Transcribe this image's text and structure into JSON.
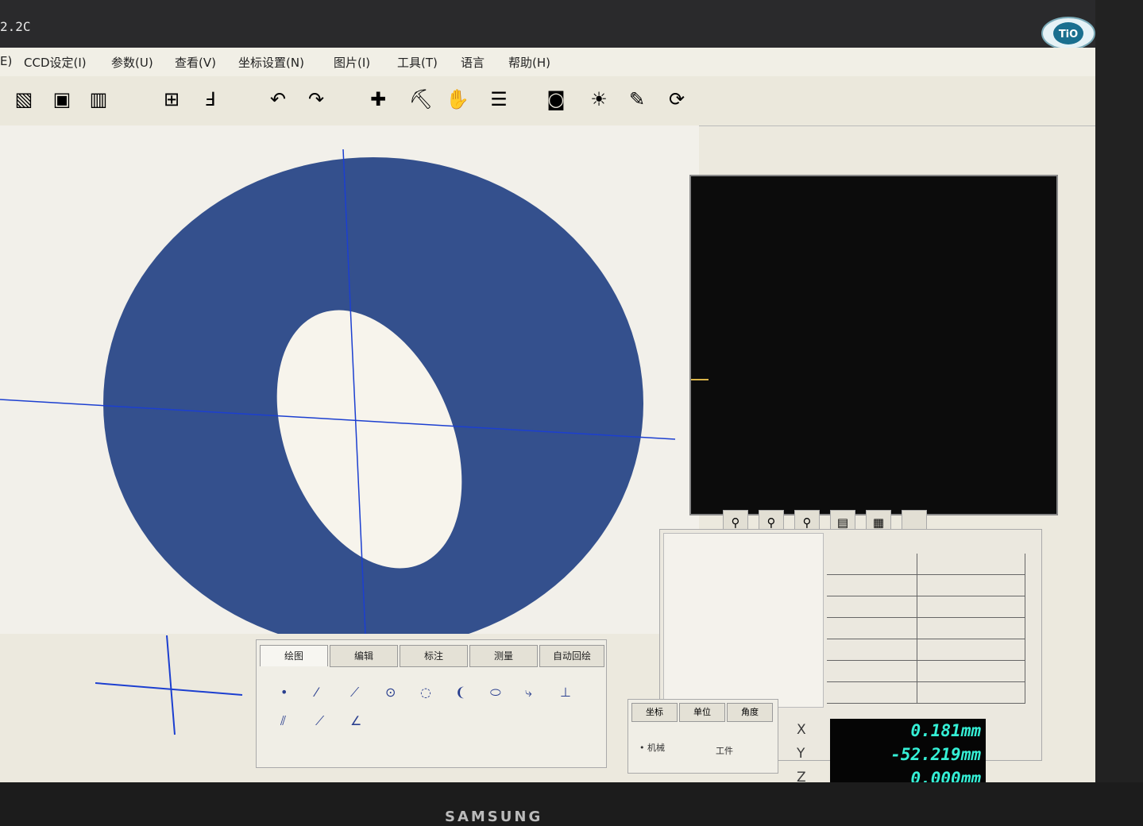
{
  "window": {
    "title": "2.2C"
  },
  "logo": {
    "text": "TiO"
  },
  "menu": [
    {
      "label": "E)"
    },
    {
      "label": "CCD设定(I)"
    },
    {
      "label": "参数(U)"
    },
    {
      "label": "查看(V)"
    },
    {
      "label": "坐标设置(N)"
    },
    {
      "label": "图片(I)"
    },
    {
      "label": "工具(T)"
    },
    {
      "label": "语言"
    },
    {
      "label": "帮助(H)"
    }
  ],
  "toolbar": [
    {
      "icon": "excel-icon",
      "glyph": "▧"
    },
    {
      "icon": "save-icon",
      "glyph": "▣"
    },
    {
      "icon": "chart-icon",
      "glyph": "▥"
    },
    {
      "icon": "calc-icon",
      "glyph": "⊞"
    },
    {
      "icon": "ruler-icon",
      "glyph": "Ⅎ"
    },
    {
      "icon": "undo-icon",
      "glyph": "↶"
    },
    {
      "icon": "redo-icon",
      "glyph": "↷"
    },
    {
      "icon": "crosshair-icon",
      "glyph": "✚"
    },
    {
      "icon": "pick-icon",
      "glyph": "⛏"
    },
    {
      "icon": "hand-icon",
      "glyph": "✋"
    },
    {
      "icon": "list-icon",
      "glyph": "☰"
    },
    {
      "icon": "camera-icon",
      "glyph": "◙"
    },
    {
      "icon": "light-icon",
      "glyph": "☀"
    },
    {
      "icon": "report-icon",
      "glyph": "✎"
    },
    {
      "icon": "refresh-icon",
      "glyph": "⟳"
    }
  ],
  "draw_tabs": [
    {
      "label": "绘图",
      "active": true
    },
    {
      "label": "编辑",
      "active": false
    },
    {
      "label": "标注",
      "active": false
    },
    {
      "label": "测量",
      "active": false
    },
    {
      "label": "自动回绘",
      "active": false
    }
  ],
  "draw_tools": [
    {
      "glyph": "•",
      "name": "point-tool"
    },
    {
      "glyph": "⁄",
      "name": "line-tool"
    },
    {
      "glyph": "⟋",
      "name": "segment-tool"
    },
    {
      "glyph": "⊙",
      "name": "circle-center-tool"
    },
    {
      "glyph": "◌",
      "name": "circle-tool"
    },
    {
      "glyph": "❨",
      "name": "arc-tool"
    },
    {
      "glyph": "⬭",
      "name": "ellipse-tool"
    },
    {
      "glyph": "⤷",
      "name": "curve-tool"
    },
    {
      "glyph": "⊥",
      "name": "perpendicular-tool"
    },
    {
      "glyph": "⫽",
      "name": "parallel-tool"
    },
    {
      "glyph": "⟋",
      "name": "slope-tool"
    },
    {
      "glyph": "∠",
      "name": "angle-tool"
    }
  ],
  "coord_tabs": [
    {
      "label": "坐标"
    },
    {
      "label": "单位"
    },
    {
      "label": "角度"
    }
  ],
  "coord_modes": {
    "machine": "机械",
    "workpiece": "工件"
  },
  "readouts": [
    {
      "axis": "X",
      "value": "0.181mm"
    },
    {
      "axis": "Y",
      "value": "-52.219mm"
    },
    {
      "axis": "Z",
      "value": "0.000mm"
    }
  ],
  "brand": "SAMSUNG",
  "colors": {
    "part": "#33508e",
    "crosshair": "#1c3fd0",
    "readout": "#35f0d6"
  }
}
